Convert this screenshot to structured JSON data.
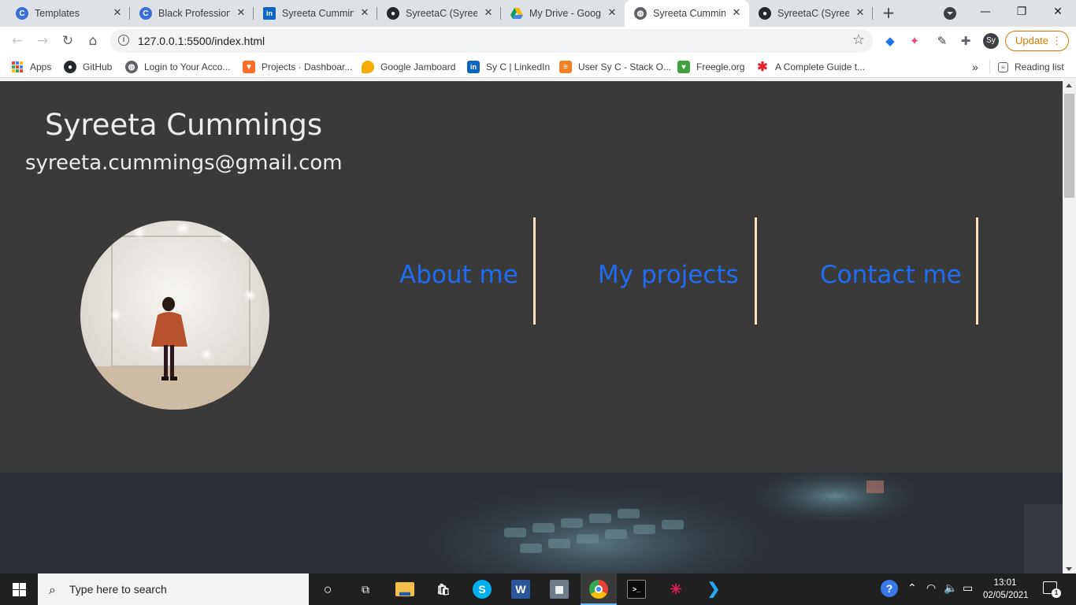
{
  "browser": {
    "tabs": [
      {
        "title": "Templates",
        "favicon": "canva-icon",
        "color": "#3b6fd8",
        "letter": "C"
      },
      {
        "title": "Black Professionals",
        "favicon": "canva-icon",
        "color": "#3b6fd8",
        "letter": "C"
      },
      {
        "title": "Syreeta Cummings",
        "favicon": "linkedin-icon",
        "color": "#0a66c2",
        "letter": "in"
      },
      {
        "title": "SyreetaC (Syreeta",
        "favicon": "github-icon",
        "color": "#24292e",
        "letter": ""
      },
      {
        "title": "My Drive - Google",
        "favicon": "google-drive-icon",
        "color": "#1fa463",
        "letter": ""
      },
      {
        "title": "Syreeta Cummings",
        "favicon": "globe-icon",
        "color": "#5f6368",
        "letter": ""
      },
      {
        "title": "SyreetaC (Syreeta",
        "favicon": "github-icon",
        "color": "#24292e",
        "letter": ""
      }
    ],
    "active_tab": 5,
    "new_tab": "+",
    "window": {
      "minimize": "—",
      "restore": "❐",
      "close": "✕"
    },
    "address": {
      "url": "127.0.0.1:5500/index.html"
    },
    "profile_initials": "Sy",
    "update_label": "Update",
    "bookmarks": [
      {
        "label": "Apps",
        "icon": "apps-grid-icon"
      },
      {
        "label": "GitHub",
        "icon": "github-icon"
      },
      {
        "label": "Login to Your Acco...",
        "icon": "globe-icon"
      },
      {
        "label": "Projects · Dashboar...",
        "icon": "gitlab-icon"
      },
      {
        "label": "Google Jamboard",
        "icon": "jamboard-icon"
      },
      {
        "label": "Sy C | LinkedIn",
        "icon": "linkedin-icon"
      },
      {
        "label": "User Sy C - Stack O...",
        "icon": "stackoverflow-icon"
      },
      {
        "label": "Freegle.org",
        "icon": "freegle-icon"
      },
      {
        "label": "A Complete Guide t...",
        "icon": "asterisk-icon"
      }
    ],
    "bookmarks_overflow": "»",
    "reading_list": "Reading list"
  },
  "page": {
    "name": "Syreeta Cummings",
    "email": "syreeta.cummings@gmail.com",
    "nav": [
      {
        "label": "About me"
      },
      {
        "label": "My projects"
      },
      {
        "label": "Contact me"
      }
    ],
    "colors": {
      "background": "#3a3a3a",
      "link": "#1f6cf0",
      "divider": "#fde0c0"
    }
  },
  "taskbar": {
    "search_placeholder": "Type here to search",
    "time": "13:01",
    "date": "02/05/2021",
    "notification_count": "1"
  }
}
